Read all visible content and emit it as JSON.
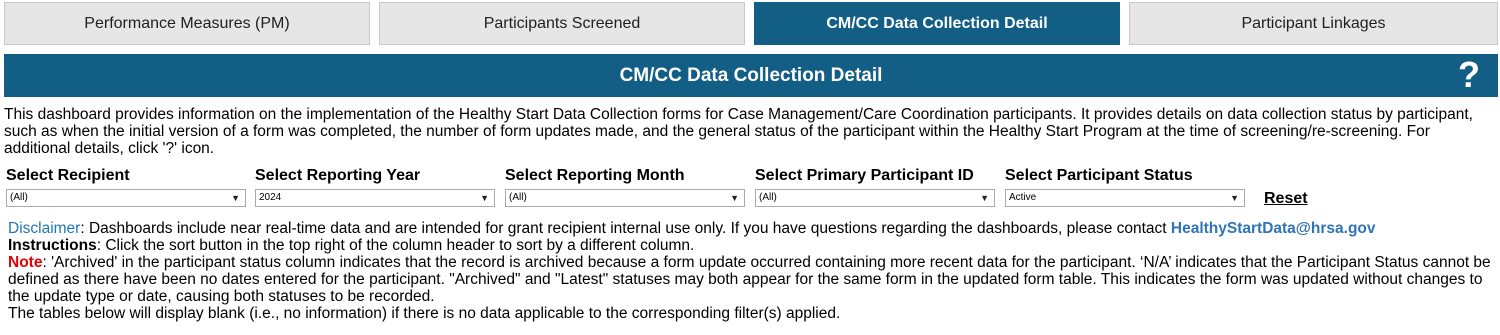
{
  "tabs": [
    {
      "label": "Performance Measures (PM)"
    },
    {
      "label": "Participants Screened"
    },
    {
      "label": "CM/CC Data Collection Detail"
    },
    {
      "label": "Participant Linkages"
    }
  ],
  "banner": {
    "title": "CM/CC Data Collection Detail",
    "help_symbol": "?"
  },
  "description": "This dashboard provides information on the implementation of the Healthy Start Data Collection forms for Case Management/Care Coordination participants. It provides details on data collection status by participant, such as when the initial version of a form was completed, the number of form updates made, and the general status of the participant within the Healthy Start Program at the time of screening/re-screening. For additional details, click '?' icon.",
  "filters": [
    {
      "label": "Select Recipient",
      "value": "(All)"
    },
    {
      "label": "Select Reporting Year",
      "value": "2024"
    },
    {
      "label": "Select Reporting Month",
      "value": "(All)"
    },
    {
      "label": "Select Primary Participant ID",
      "value": "(All)"
    },
    {
      "label": "Select Participant Status",
      "value": "Active"
    }
  ],
  "reset_label": "Reset",
  "info": {
    "disclaimer_label": "Disclaimer",
    "disclaimer_text": ": Dashboards include near real-time data and are intended for grant recipient internal use only. If you have questions regarding the dashboards, please contact ",
    "email": "HealthyStartData@hrsa.gov",
    "instructions_label": "Instructions",
    "instructions_text": ": Click the sort button in the top right of the column header to sort by a different column.",
    "note_label": "Note",
    "note_text": ": 'Archived' in the participant status column indicates that the record is archived because a form update occurred containing more recent data for the participant. ‘N/A’ indicates that the Participant Status cannot be defined as there have been no dates entered for the participant. \"Archived\" and \"Latest\" statuses may both appear for the same form in the updated form table.  This indicates the form was updated without changes to the update type or date, causing both statuses to be recorded.",
    "tables_text": "The tables below will display blank (i.e., no information) if there is no data applicable to the corresponding filter(s) applied."
  },
  "colors": {
    "primary": "#135e84",
    "tab_inactive": "#e6e6e6",
    "disclaimer": "#1f77b4",
    "note": "#e00000",
    "email": "#2f75b5"
  },
  "icons": {
    "help": "question-mark-icon",
    "dropdown": "chevron-down-icon"
  }
}
